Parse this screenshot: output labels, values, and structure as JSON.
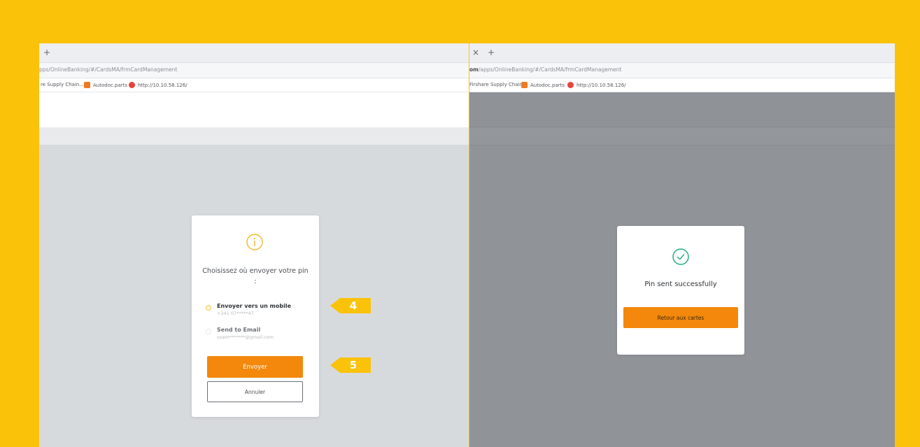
{
  "left_window": {
    "tab_new": "+",
    "url": "pps/OnlineBanking/#/CardsMA/frmCardManagement",
    "bookmarks": [
      "re Supply Chain...",
      "Autodoc.parts",
      "http://10.10.58.126/"
    ],
    "dialog": {
      "title": "Choisissez où envoyer votre pin :",
      "options": [
        {
          "label": "Envoyer vers un mobile",
          "detail": "+241 07*****47",
          "selected": true
        },
        {
          "label": "Send to Email",
          "detail": "ozam*******@gmail.com",
          "selected": false
        }
      ],
      "primary_button": "Envoyer",
      "secondary_button": "Annuler"
    }
  },
  "right_window": {
    "tab_close": "×",
    "tab_new": "+",
    "url_prefix": "om",
    "url": "/apps/OnlineBanking/#/CardsMA/frmCardManagement",
    "bookmarks": [
      "Firshare Supply Chain...",
      "Autodoc.parts",
      "http://10.10.58.126/"
    ],
    "dialog": {
      "message": "Pin sent successfully",
      "button": "Retour aux cartes"
    }
  },
  "steps": [
    "4",
    "5"
  ],
  "colors": {
    "frame": "#fbc20a",
    "accent": "#f3880c",
    "success": "#22b07d",
    "info": "#f5b82a"
  }
}
